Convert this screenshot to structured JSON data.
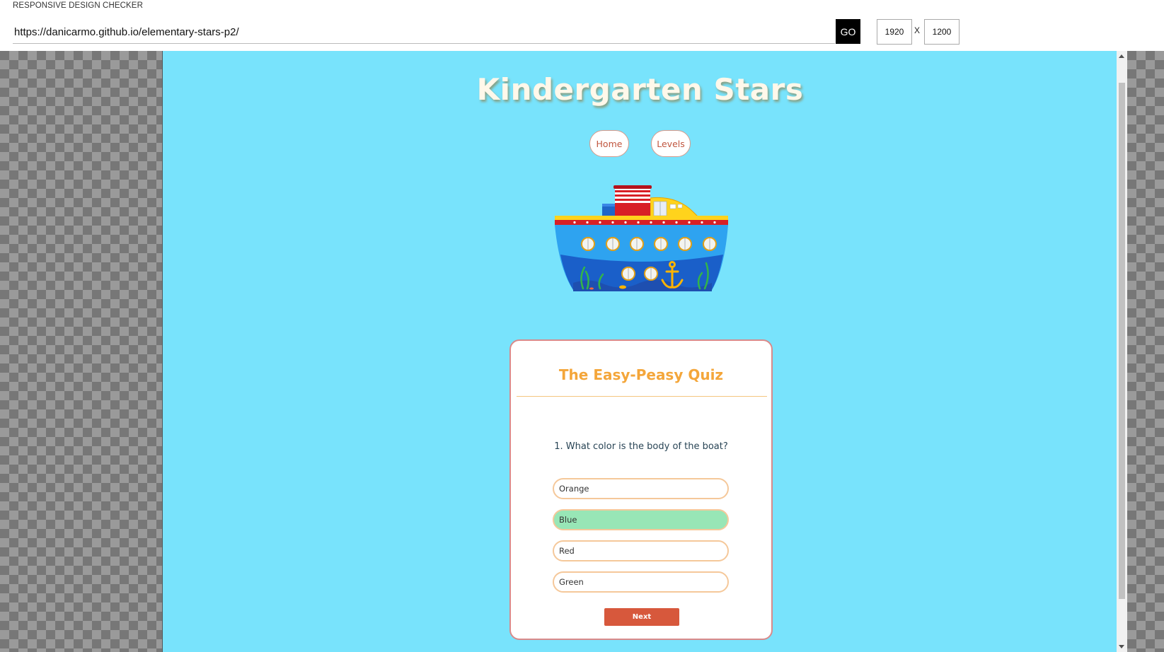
{
  "app": {
    "title": "RESPONSIVE DESIGN CHECKER"
  },
  "toolbar": {
    "url": "https://danicarmo.github.io/elementary-stars-p2/",
    "go_label": "GO",
    "width": "1920",
    "height": "1200",
    "separator": "X"
  },
  "site": {
    "title": "Kindergarten Stars",
    "nav": {
      "home": "Home",
      "levels": "Levels"
    }
  },
  "quiz": {
    "title": "The Easy-Peasy Quiz",
    "question": "1. What color is the body of the boat?",
    "answers": [
      "Orange",
      "Blue",
      "Red",
      "Green"
    ],
    "selected_answer": "Blue",
    "next_label": "Next"
  },
  "colors": {
    "page_background": "#78e3fc",
    "accent_title": "#f4a63a",
    "nav_text": "#c0563f",
    "next_button": "#d7583c",
    "selected_answer": "#98e6b6"
  }
}
